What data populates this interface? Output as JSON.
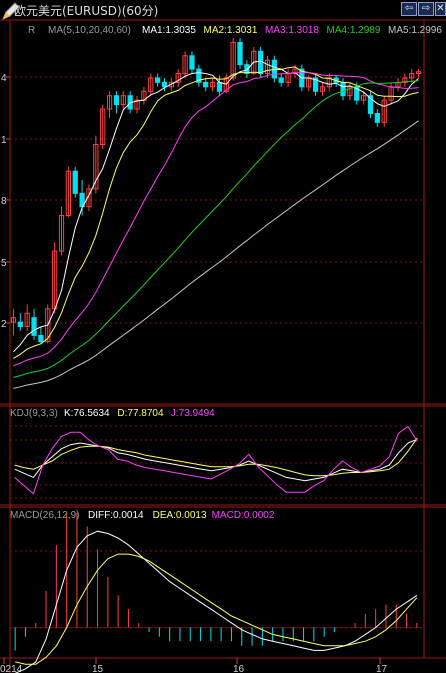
{
  "title_bar": {
    "title": "欧元美元(EURUSD)(60分)",
    "buttons": [
      {
        "name": "prev",
        "label": "⇦"
      },
      {
        "name": "next",
        "label": "⇨"
      },
      {
        "name": "close",
        "label": "✕"
      }
    ]
  },
  "colors": {
    "background": "#000000",
    "up_candle": "#ff4040",
    "down_candle": "#00e0f0",
    "ma1": "#ffffff",
    "ma2": "#ffff60",
    "ma3": "#ff40ff",
    "ma4": "#20d020",
    "ma5": "#c8c8c8",
    "grid": "#7a1515",
    "macd_up": "#ff4040",
    "macd_down": "#00e0f0"
  },
  "price_panel": {
    "left_label": "R",
    "ma_label": "MA(5,10,20,40,60)",
    "ma_values": [
      {
        "label": "MA1:1.3035",
        "color": "#ffffff"
      },
      {
        "label": "MA2:1.3031",
        "color": "#ffff60"
      },
      {
        "label": "MA3:1.3018",
        "color": "#ff40ff"
      },
      {
        "label": "MA4:1.2989",
        "color": "#20d020"
      },
      {
        "label": "MA5:1.2996",
        "color": "#c8c8c8"
      }
    ],
    "axis_tick_labels": [
      "4",
      "1",
      "8",
      "5",
      "2"
    ]
  },
  "kdj_panel": {
    "label": "KDJ(9,3,3)",
    "values": [
      {
        "label": "K:76.5634",
        "color": "#ffffff"
      },
      {
        "label": "D:77.8704",
        "color": "#ffff60"
      },
      {
        "label": "J:73.9494",
        "color": "#ff40ff"
      }
    ]
  },
  "macd_panel": {
    "label": "MACD(26,12,9)",
    "values": [
      {
        "label": "DIFF:0.0014",
        "color": "#ffffff"
      },
      {
        "label": "DEA:0.0013",
        "color": "#ffff60"
      },
      {
        "label": "MACD:0.0002",
        "color": "#ff40ff"
      }
    ]
  },
  "time_axis": {
    "labels": [
      "0214",
      "15",
      "16",
      "17"
    ]
  },
  "chart_data": {
    "type": "candlestick",
    "title": "欧元美元(EURUSD)(60分)",
    "interval": "60分",
    "time_labels": [
      "0214",
      "15",
      "16",
      "17"
    ],
    "ylim": [
      1.265,
      1.306
    ],
    "candles": [
      [
        1.274,
        1.2755,
        1.2725,
        1.2745
      ],
      [
        1.274,
        1.275,
        1.273,
        1.2735
      ],
      [
        1.2735,
        1.276,
        1.273,
        1.275
      ],
      [
        1.2745,
        1.2755,
        1.272,
        1.2725
      ],
      [
        1.2725,
        1.2735,
        1.2715,
        1.2718
      ],
      [
        1.2718,
        1.276,
        1.2716,
        1.2755
      ],
      [
        1.2755,
        1.283,
        1.275,
        1.282
      ],
      [
        1.282,
        1.287,
        1.2815,
        1.286
      ],
      [
        1.286,
        1.2915,
        1.2858,
        1.291
      ],
      [
        1.291,
        1.2915,
        1.288,
        1.2885
      ],
      [
        1.2885,
        1.29,
        1.286,
        1.287
      ],
      [
        1.287,
        1.2895,
        1.2865,
        1.289
      ],
      [
        1.289,
        1.295,
        1.2885,
        1.294
      ],
      [
        1.294,
        1.2985,
        1.2935,
        1.298
      ],
      [
        1.298,
        1.3,
        1.297,
        1.2995
      ],
      [
        1.2995,
        1.3,
        1.2975,
        1.2985
      ],
      [
        1.2985,
        1.3,
        1.298,
        1.2995
      ],
      [
        1.2995,
        1.3,
        1.2975,
        1.298
      ],
      [
        1.298,
        1.2995,
        1.2975,
        1.299
      ],
      [
        1.299,
        1.3005,
        1.2985,
        1.3
      ],
      [
        1.3,
        1.302,
        1.2995,
        1.3015
      ],
      [
        1.3015,
        1.302,
        1.3005,
        1.301
      ],
      [
        1.301,
        1.3015,
        1.3,
        1.3005
      ],
      [
        1.3005,
        1.3015,
        1.3,
        1.301
      ],
      [
        1.301,
        1.3025,
        1.3005,
        1.302
      ],
      [
        1.302,
        1.3045,
        1.3015,
        1.304
      ],
      [
        1.304,
        1.3045,
        1.302,
        1.3025
      ],
      [
        1.3025,
        1.303,
        1.3005,
        1.301
      ],
      [
        1.301,
        1.3015,
        1.3,
        1.3005
      ],
      [
        1.3005,
        1.3015,
        1.3,
        1.301
      ],
      [
        1.301,
        1.3018,
        1.2995,
        1.3
      ],
      [
        1.3,
        1.302,
        1.2998,
        1.3015
      ],
      [
        1.3015,
        1.306,
        1.3012,
        1.3055
      ],
      [
        1.3055,
        1.306,
        1.3025,
        1.303
      ],
      [
        1.303,
        1.3035,
        1.3015,
        1.302
      ],
      [
        1.302,
        1.305,
        1.3018,
        1.3045
      ],
      [
        1.3045,
        1.305,
        1.3015,
        1.302
      ],
      [
        1.302,
        1.304,
        1.3015,
        1.3035
      ],
      [
        1.3035,
        1.304,
        1.301,
        1.3015
      ],
      [
        1.3015,
        1.302,
        1.3005,
        1.301
      ],
      [
        1.301,
        1.3025,
        1.3005,
        1.302
      ],
      [
        1.302,
        1.303,
        1.3015,
        1.3025
      ],
      [
        1.3025,
        1.303,
        1.3,
        1.3005
      ],
      [
        1.3005,
        1.3018,
        1.3,
        1.3015
      ],
      [
        1.3015,
        1.302,
        1.2995,
        1.3
      ],
      [
        1.3,
        1.301,
        1.2995,
        1.3005
      ],
      [
        1.3005,
        1.302,
        1.3,
        1.3015
      ],
      [
        1.3015,
        1.3018,
        1.3005,
        1.301
      ],
      [
        1.301,
        1.3015,
        1.299,
        1.2995
      ],
      [
        1.2995,
        1.301,
        1.299,
        1.3005
      ],
      [
        1.3005,
        1.301,
        1.2985,
        1.299
      ],
      [
        1.299,
        1.3,
        1.2985,
        1.2995
      ],
      [
        1.2995,
        1.3,
        1.297,
        1.2975
      ],
      [
        1.2975,
        1.298,
        1.296,
        1.2965
      ],
      [
        1.2965,
        1.2995,
        1.296,
        1.299
      ],
      [
        1.299,
        1.301,
        1.2985,
        1.3005
      ],
      [
        1.3005,
        1.3015,
        1.3,
        1.301
      ],
      [
        1.301,
        1.302,
        1.3005,
        1.3015
      ],
      [
        1.3015,
        1.3025,
        1.301,
        1.302
      ],
      [
        1.302,
        1.3025,
        1.3015,
        1.3022
      ]
    ],
    "kdj": {
      "k": [
        40,
        35,
        30,
        45,
        55,
        65,
        70,
        72,
        70,
        68,
        66,
        60,
        58,
        55,
        52,
        50,
        48,
        46,
        44,
        42,
        40,
        38,
        40,
        42,
        45,
        50,
        45,
        40,
        35,
        30,
        28,
        26,
        28,
        30,
        35,
        40,
        38,
        36,
        38,
        40,
        45,
        60,
        72,
        76.5634
      ],
      "d": [
        45,
        42,
        40,
        45,
        50,
        58,
        63,
        67,
        68,
        68,
        67,
        64,
        62,
        60,
        57,
        55,
        53,
        51,
        49,
        47,
        45,
        43,
        43,
        43,
        44,
        46,
        46,
        44,
        42,
        39,
        36,
        33,
        32,
        32,
        33,
        35,
        36,
        36,
        37,
        38,
        40,
        48,
        62,
        77.8704
      ],
      "j": [
        30,
        20,
        10,
        45,
        65,
        80,
        85,
        85,
        75,
        68,
        64,
        52,
        50,
        45,
        42,
        40,
        38,
        36,
        34,
        32,
        30,
        28,
        34,
        40,
        47,
        58,
        43,
        32,
        21,
        12,
        12,
        12,
        20,
        26,
        39,
        50,
        42,
        36,
        40,
        44,
        55,
        84,
        92,
        73.9494
      ]
    },
    "macd": {
      "diff": [
        -0.002,
        -0.0018,
        -0.0015,
        -0.0005,
        0.001,
        0.0025,
        0.0035,
        0.004,
        0.0042,
        0.0041,
        0.0039,
        0.0036,
        0.0032,
        0.0028,
        0.0024,
        0.002,
        0.0017,
        0.0014,
        0.0011,
        0.0008,
        0.0005,
        0.0002,
        -0.0001,
        -0.0003,
        -0.0005,
        -0.0006,
        -0.0007,
        -0.0008,
        -0.0009,
        -0.001,
        -0.001,
        -0.0009,
        -0.0008,
        -0.0006,
        -0.0003,
        0.0,
        0.0004,
        0.0008,
        0.0011,
        0.0014
      ],
      "dea": [
        -0.0015,
        -0.0016,
        -0.0016,
        -0.0013,
        -0.0008,
        0.0,
        0.001,
        0.0018,
        0.0025,
        0.003,
        0.0032,
        0.0032,
        0.0031,
        0.0029,
        0.0026,
        0.0023,
        0.002,
        0.0017,
        0.0014,
        0.0011,
        0.0008,
        0.0005,
        0.0003,
        0.0001,
        -0.0001,
        -0.0003,
        -0.0004,
        -0.0005,
        -0.0006,
        -0.0007,
        -0.0008,
        -0.0008,
        -0.0008,
        -0.0007,
        -0.0006,
        -0.0004,
        -0.0001,
        0.0003,
        0.0008,
        0.0013
      ],
      "hist": [
        -0.001,
        -0.0004,
        0.0002,
        0.0016,
        0.0036,
        0.005,
        0.005,
        0.0044,
        0.0034,
        0.0022,
        0.0014,
        0.0008,
        0.0002,
        -0.0002,
        -0.0004,
        -0.0006,
        -0.0006,
        -0.0006,
        -0.0006,
        -0.0006,
        -0.0006,
        -0.0006,
        -0.0008,
        -0.0008,
        -0.0008,
        -0.0006,
        -0.0006,
        -0.0006,
        -0.0006,
        -0.0006,
        -0.0004,
        -0.0002,
        0.0,
        0.0002,
        0.0006,
        0.0008,
        0.001,
        0.001,
        0.0006,
        0.0002
      ]
    }
  }
}
